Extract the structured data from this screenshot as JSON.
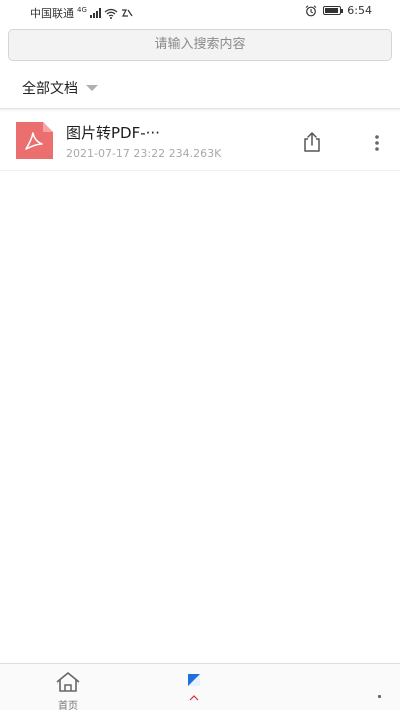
{
  "status_bar": {
    "carrier": "中国联通",
    "network": "4G",
    "time": "6:54"
  },
  "search": {
    "placeholder": "请输入搜索内容"
  },
  "filter": {
    "label": "全部文档"
  },
  "files": [
    {
      "name": "图片转PDF-···",
      "date": "2021-07-17 23:22",
      "size": "234.263K",
      "meta": "2021-07-17 23:22 234.263K",
      "icon": "pdf-icon"
    }
  ],
  "bottom_nav": {
    "home_label": "首页"
  },
  "colors": {
    "pdf_icon": "#eb6f6f",
    "search_bg": "#f3f3f3",
    "text_secondary": "#a9a9a9"
  }
}
